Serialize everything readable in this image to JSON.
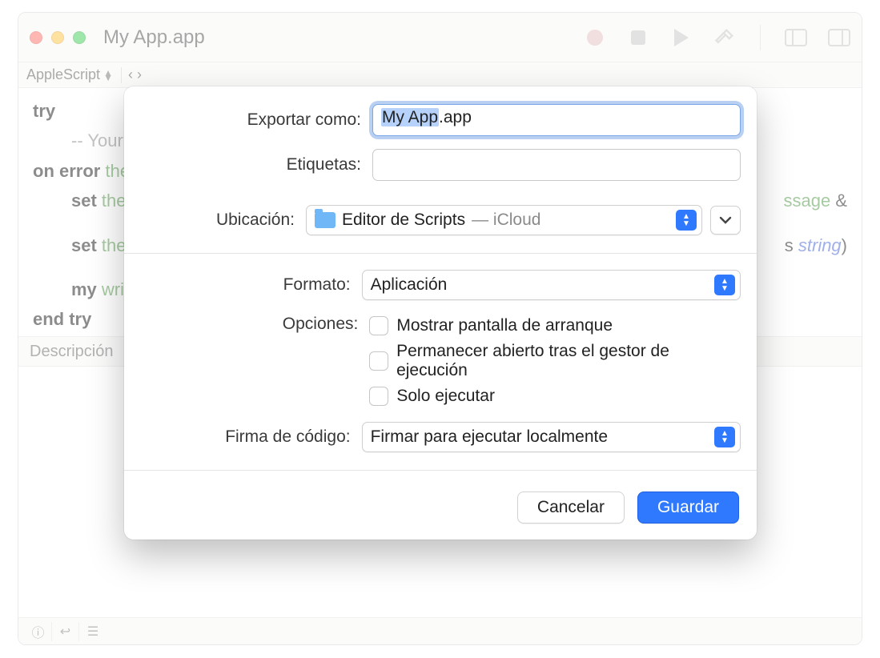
{
  "window": {
    "title": "My App.app",
    "language_selector": "AppleScript"
  },
  "editor": {
    "line1_kw": "try",
    "line2_comment": "-- Your",
    "line3_a": "on error",
    "line3_b": " the",
    "line4_a": "set",
    "line4_b": " the",
    "line4_tail_a": "ssage",
    "line4_tail_b": " &",
    "line5_a": "set",
    "line5_b": " the",
    "line5_tail_a": "s ",
    "line5_tail_b": "string",
    "line5_tail_c": ")",
    "line6_a": "my",
    "line6_b": " writ",
    "line7": "end try"
  },
  "desc_tab": "Descripción",
  "sheet": {
    "export_as_label": "Exportar como:",
    "filename_selected": "My App",
    "filename_rest": ".app",
    "tags_label": "Etiquetas:",
    "location_label": "Ubicación:",
    "location_folder": "Editor de Scripts",
    "location_suffix": " — iCloud",
    "format_label": "Formato:",
    "format_value": "Aplicación",
    "options_label": "Opciones:",
    "opt1": "Mostrar pantalla de arranque",
    "opt2": "Permanecer abierto tras el gestor de ejecución",
    "opt3": "Solo ejecutar",
    "codesign_label": "Firma de código:",
    "codesign_value": "Firmar para ejecutar localmente",
    "cancel": "Cancelar",
    "save": "Guardar"
  }
}
